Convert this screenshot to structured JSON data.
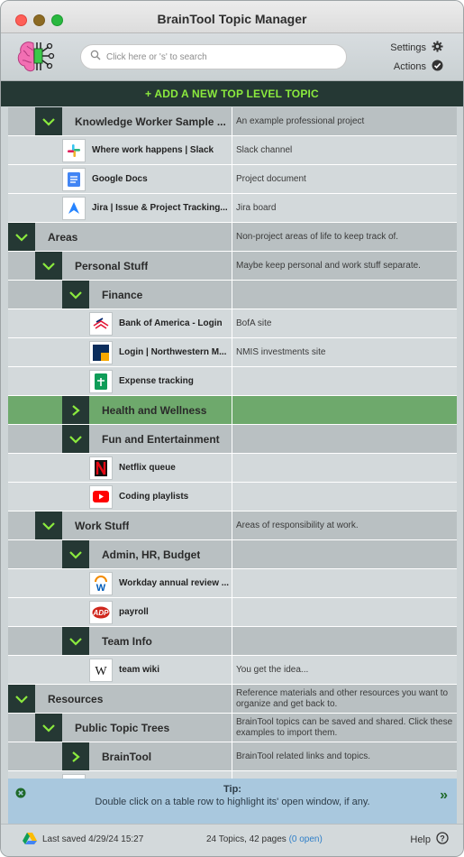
{
  "window": {
    "title": "BrainTool Topic Manager"
  },
  "header": {
    "search_placeholder": "Click here or 's' to search",
    "settings_label": "Settings",
    "actions_label": "Actions",
    "add_topic_label": "+ ADD A NEW TOP LEVEL TOPIC"
  },
  "rows": [
    {
      "kind": "topic",
      "level": 1,
      "state": "expanded",
      "label": "Knowledge Worker Sample ...",
      "desc": "An example professional project"
    },
    {
      "kind": "link",
      "level": 2,
      "icon": "slack-icon",
      "label": "Where work happens | Slack",
      "desc": "Slack channel"
    },
    {
      "kind": "link",
      "level": 2,
      "icon": "google-docs-icon",
      "label": "Google Docs",
      "desc": "Project document"
    },
    {
      "kind": "link",
      "level": 2,
      "icon": "jira-icon",
      "label": "Jira | Issue & Project Tracking...",
      "desc": "Jira board"
    },
    {
      "kind": "topic",
      "level": 0,
      "state": "expanded",
      "label": "Areas",
      "desc": "Non-project areas of life to keep track of."
    },
    {
      "kind": "topic",
      "level": 1,
      "state": "expanded",
      "label": "Personal Stuff",
      "desc": "Maybe keep personal and work stuff separate."
    },
    {
      "kind": "topic",
      "level": 2,
      "state": "expanded",
      "label": "Finance",
      "desc": ""
    },
    {
      "kind": "link",
      "level": 3,
      "icon": "bank-of-america-icon",
      "label": "Bank of America - Login",
      "desc": "BofA site"
    },
    {
      "kind": "link",
      "level": 3,
      "icon": "northwestern-icon",
      "label": "Login | Northwestern M...",
      "desc": "NMIS investments site"
    },
    {
      "kind": "link",
      "level": 3,
      "icon": "google-sheets-icon",
      "label": "Expense tracking",
      "desc": ""
    },
    {
      "kind": "topic",
      "level": 2,
      "state": "collapsed",
      "selected": true,
      "label": "Health and Wellness",
      "desc": ""
    },
    {
      "kind": "topic",
      "level": 2,
      "state": "expanded",
      "label": "Fun and Entertainment",
      "desc": ""
    },
    {
      "kind": "link",
      "level": 3,
      "icon": "netflix-icon",
      "label": "Netflix queue",
      "desc": ""
    },
    {
      "kind": "link",
      "level": 3,
      "icon": "youtube-icon",
      "label": "Coding playlists",
      "desc": ""
    },
    {
      "kind": "topic",
      "level": 1,
      "state": "expanded",
      "label": "Work Stuff",
      "desc": "Areas of responsibility at work."
    },
    {
      "kind": "topic",
      "level": 2,
      "state": "expanded",
      "label": "Admin, HR, Budget",
      "desc": ""
    },
    {
      "kind": "link",
      "level": 3,
      "icon": "workday-icon",
      "label": "Workday annual review ...",
      "desc": ""
    },
    {
      "kind": "link",
      "level": 3,
      "icon": "adp-icon",
      "label": "payroll",
      "desc": ""
    },
    {
      "kind": "topic",
      "level": 2,
      "state": "expanded",
      "label": "Team Info",
      "desc": ""
    },
    {
      "kind": "link",
      "level": 3,
      "icon": "wikipedia-icon",
      "label": "team wiki",
      "desc": "You get the idea..."
    },
    {
      "kind": "topic",
      "level": 0,
      "state": "expanded",
      "label": "Resources",
      "desc": "Reference materials and other resources you want to organize and get back to."
    },
    {
      "kind": "topic",
      "level": 1,
      "state": "expanded",
      "label": "Public Topic Trees",
      "desc": "BrainTool topics can be saved and shared. Click these examples to import them."
    },
    {
      "kind": "topic",
      "level": 2,
      "state": "collapsed",
      "label": "BrainTool",
      "desc": "BrainTool related links and topics."
    },
    {
      "kind": "link",
      "level": 2,
      "icon": "partial-icon",
      "label": "",
      "desc": ""
    }
  ],
  "tip": {
    "title": "Tip:",
    "text": "Double click on a table row to highlight its' open window, if any."
  },
  "footer": {
    "saved": "Last saved 4/29/24 15:27",
    "stats": "24 Topics, 42 pages",
    "open": "(0 open)",
    "help": "Help"
  },
  "colors": {
    "toggle_bg": "#253834",
    "toggle_arrow": "#8bea3e",
    "selected_row": "#6ea96c",
    "topic_row": "#b9c0c2",
    "link_row": "#d3d9db",
    "tip_bg": "#a9c8de"
  }
}
